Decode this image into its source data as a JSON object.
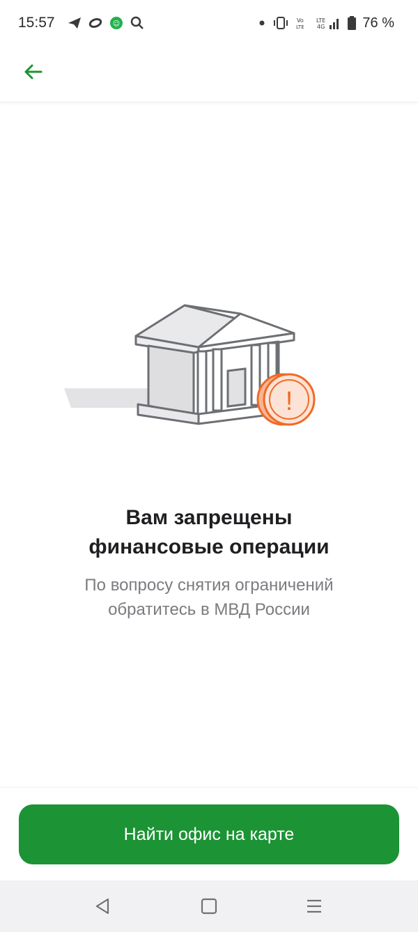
{
  "status_bar": {
    "time": "15:57",
    "battery_percent": "76 %",
    "icons_left": [
      "telegram-icon",
      "loop-icon",
      "app-shield-icon",
      "search-icon"
    ],
    "icons_right": [
      "dot-icon",
      "vibrate-icon",
      "volte-icon",
      "lte-icon",
      "signal-icon",
      "battery-icon"
    ]
  },
  "header": {
    "back_icon": "arrow-left-icon"
  },
  "illustration": {
    "icon": "bank-building-with-warning-coin-icon",
    "warning_glyph": "!",
    "accent_color": "#f06a25"
  },
  "main": {
    "title": "Вам запрещены финансовые операции",
    "title_line1": "Вам запрещены",
    "title_line2": "финансовые операции",
    "subtitle_line1": "По вопросу снятия ограничений",
    "subtitle_line2": "обратитесь в МВД России"
  },
  "action": {
    "button_label": "Найти офис на карте",
    "button_color": "#1c9334"
  },
  "nav": {
    "items": [
      "back-triangle-icon",
      "home-square-icon",
      "menu-lines-icon"
    ]
  }
}
